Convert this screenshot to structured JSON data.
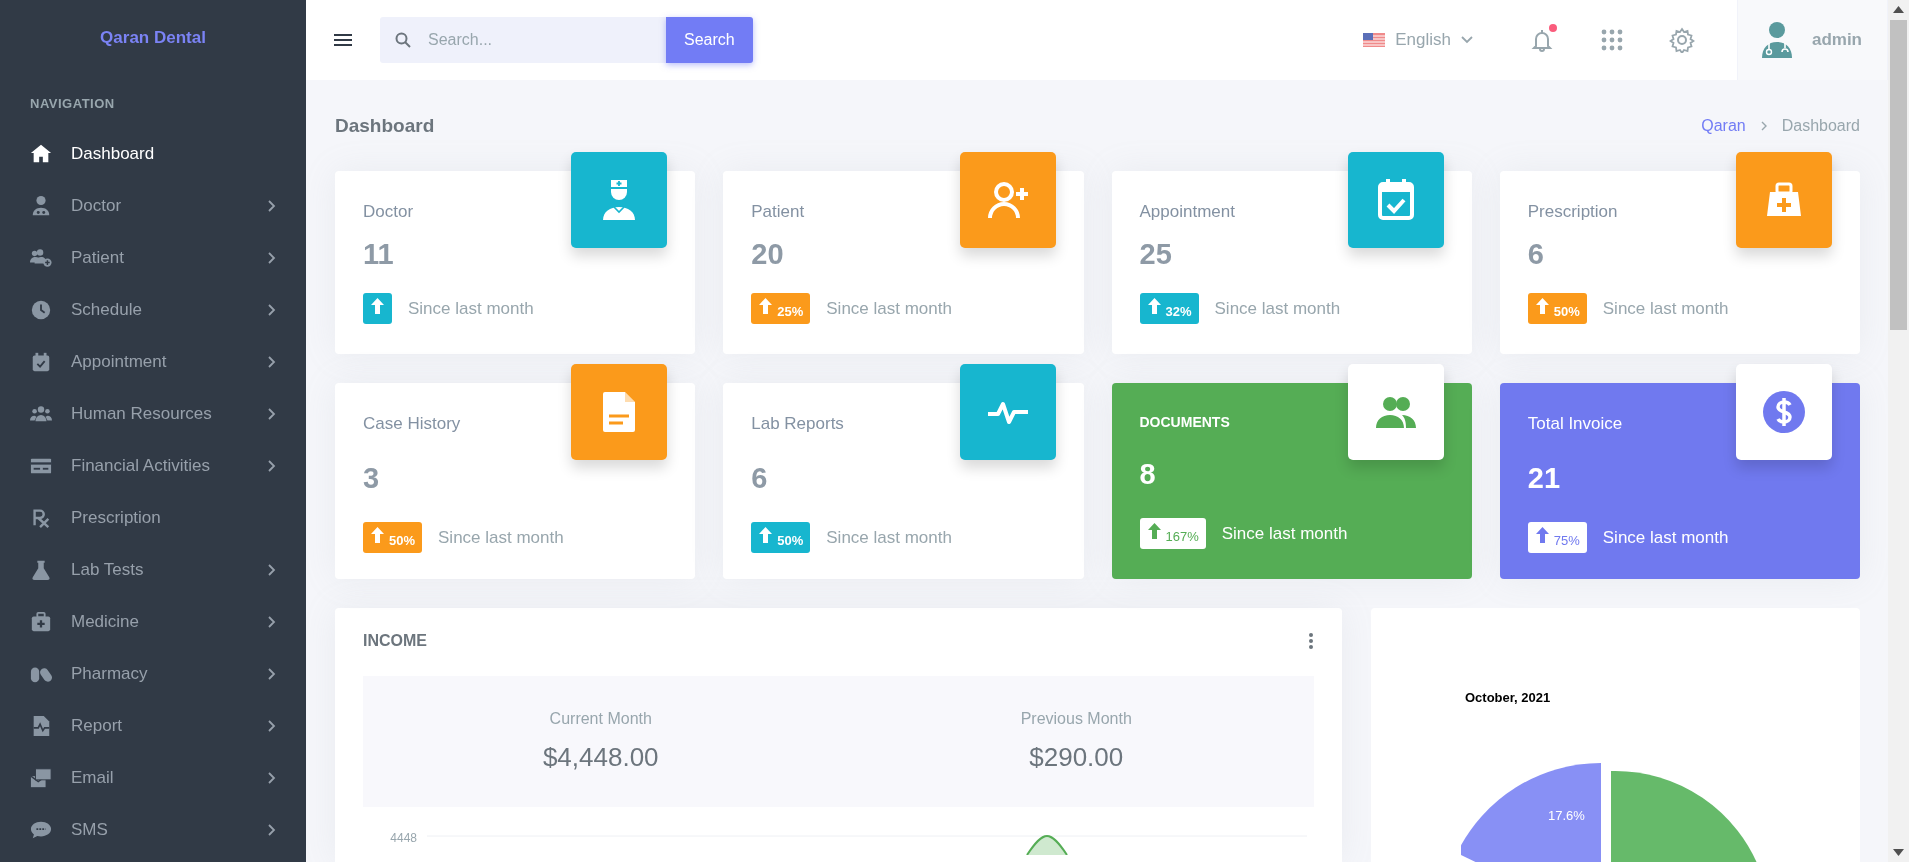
{
  "brand": "Qaran Dental",
  "sidebar": {
    "heading": "NAVIGATION",
    "items": [
      {
        "label": "Dashboard",
        "selected": true,
        "expandable": false
      },
      {
        "label": "Doctor",
        "selected": false,
        "expandable": true
      },
      {
        "label": "Patient",
        "selected": false,
        "expandable": true
      },
      {
        "label": "Schedule",
        "selected": false,
        "expandable": true
      },
      {
        "label": "Appointment",
        "selected": false,
        "expandable": true
      },
      {
        "label": "Human Resources",
        "selected": false,
        "expandable": true
      },
      {
        "label": "Financial Activities",
        "selected": false,
        "expandable": true
      },
      {
        "label": "Prescription",
        "selected": false,
        "expandable": false
      },
      {
        "label": "Lab Tests",
        "selected": false,
        "expandable": true
      },
      {
        "label": "Medicine",
        "selected": false,
        "expandable": true
      },
      {
        "label": "Pharmacy",
        "selected": false,
        "expandable": true
      },
      {
        "label": "Report",
        "selected": false,
        "expandable": true
      },
      {
        "label": "Email",
        "selected": false,
        "expandable": true
      },
      {
        "label": "SMS",
        "selected": false,
        "expandable": true
      }
    ]
  },
  "topbar": {
    "search": {
      "placeholder": "Search...",
      "button": "Search"
    },
    "language": "English",
    "notifications_unread": true,
    "user": "admin"
  },
  "page": {
    "title": "Dashboard",
    "breadcrumb": [
      "Qaran",
      "Dashboard"
    ]
  },
  "cards": [
    {
      "kind": "light",
      "title": "Doctor",
      "title_bold": false,
      "value": "11",
      "color": "#17b6cf",
      "caption": "Since last month"
    },
    {
      "kind": "light",
      "title": "Patient",
      "title_bold": false,
      "value": "20",
      "color": "#fb9a1b",
      "percent": "25%",
      "caption": "Since last month"
    },
    {
      "kind": "light",
      "title": "Appointment",
      "title_bold": false,
      "value": "25",
      "color": "#17b6cf",
      "percent": "32%",
      "caption": "Since last month"
    },
    {
      "kind": "light",
      "title": "Prescription",
      "title_bold": false,
      "value": "6",
      "color": "#fb9a1b",
      "percent": "50%",
      "caption": "Since last month"
    },
    {
      "kind": "light",
      "title": "Case History",
      "title_bold": false,
      "value": "3",
      "color": "#fb9a1b",
      "percent": "50%",
      "caption": "Since last month"
    },
    {
      "kind": "light",
      "title": "Lab Reports",
      "title_bold": false,
      "value": "6",
      "color": "#17b6cf",
      "percent": "50%",
      "caption": "Since last month"
    },
    {
      "kind": "filled",
      "title": "DOCUMENTS",
      "title_bold": true,
      "value": "8",
      "color": "#55ad55",
      "percent": "167%",
      "caption": "Since last month"
    },
    {
      "kind": "filled",
      "title": "Total Invoice",
      "title_bold": false,
      "value": "21",
      "color": "#7079ef",
      "percent": "75%",
      "caption": "Since last month"
    }
  ],
  "income": {
    "title": "INCOME",
    "summary": [
      {
        "label": "Current Month",
        "amount": "$4,448.00"
      },
      {
        "label": "Previous Month",
        "amount": "$290.00"
      }
    ],
    "chart_tick": "4448"
  },
  "pie": {
    "title": "October, 2021",
    "slice_label": "17.6%"
  }
}
